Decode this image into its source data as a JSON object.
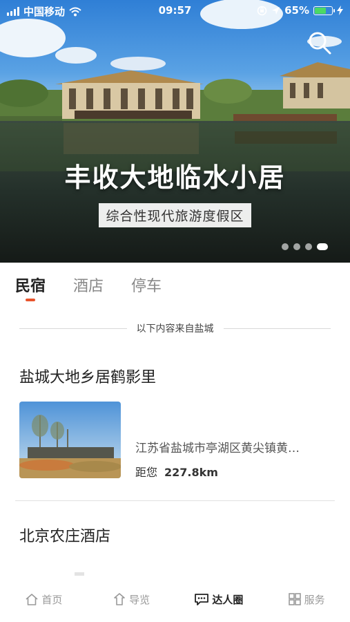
{
  "status_bar": {
    "carrier": "中国移动",
    "time": "09:57",
    "battery_percent": "65%",
    "battery_level": 0.65,
    "battery_color": "#4cd964"
  },
  "hero": {
    "title": "丰收大地临水小居",
    "subtitle": "综合性现代旅游度假区",
    "slide_count": 4,
    "active_slide": 4,
    "search_icon": "search-icon"
  },
  "tabs": [
    {
      "label": "民宿",
      "active": true
    },
    {
      "label": "酒店",
      "active": false
    },
    {
      "label": "停车",
      "active": false
    }
  ],
  "accent_color": "#e8542c",
  "source_notice": "以下内容来自盐城",
  "listings": [
    {
      "title": "盐城大地乡居鹤影里",
      "address": "江苏省盐城市亭湖区黄尖镇黄…",
      "distance_label": "距您",
      "distance_value": "227.8km"
    },
    {
      "title": "北京农庄酒店"
    }
  ],
  "bottom_nav": [
    {
      "label": "首页",
      "icon": "home-icon",
      "active": false
    },
    {
      "label": "导览",
      "icon": "guide-icon",
      "active": false
    },
    {
      "label": "达人圈",
      "icon": "chat-icon",
      "active": true
    },
    {
      "label": "服务",
      "icon": "grid-icon",
      "active": false
    }
  ]
}
